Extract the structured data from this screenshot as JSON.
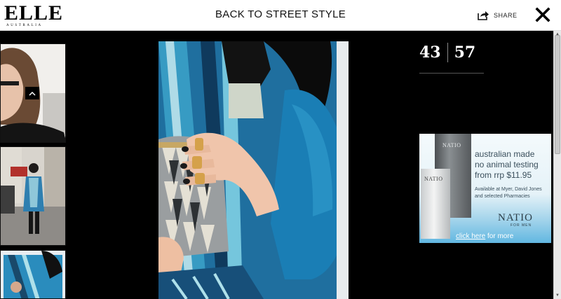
{
  "header": {
    "logo": "ELLE",
    "logo_sub": "AUSTRALIA",
    "back_label": "BACK TO STREET STYLE",
    "share_label": "SHARE"
  },
  "gallery": {
    "current": "43",
    "total": "57"
  },
  "ad": {
    "line1": "australian made",
    "line2": "no animal testing",
    "line3": "from rrp $11.95",
    "small1": "Available at Myer, David Jones",
    "small2": "and selected Pharmacies",
    "brand": "NATIO",
    "brand_sub": "FOR MEN",
    "tube1_label": "NATIO",
    "tube2_label": "NATIO",
    "click_link": "click here",
    "click_rest": " for more"
  }
}
